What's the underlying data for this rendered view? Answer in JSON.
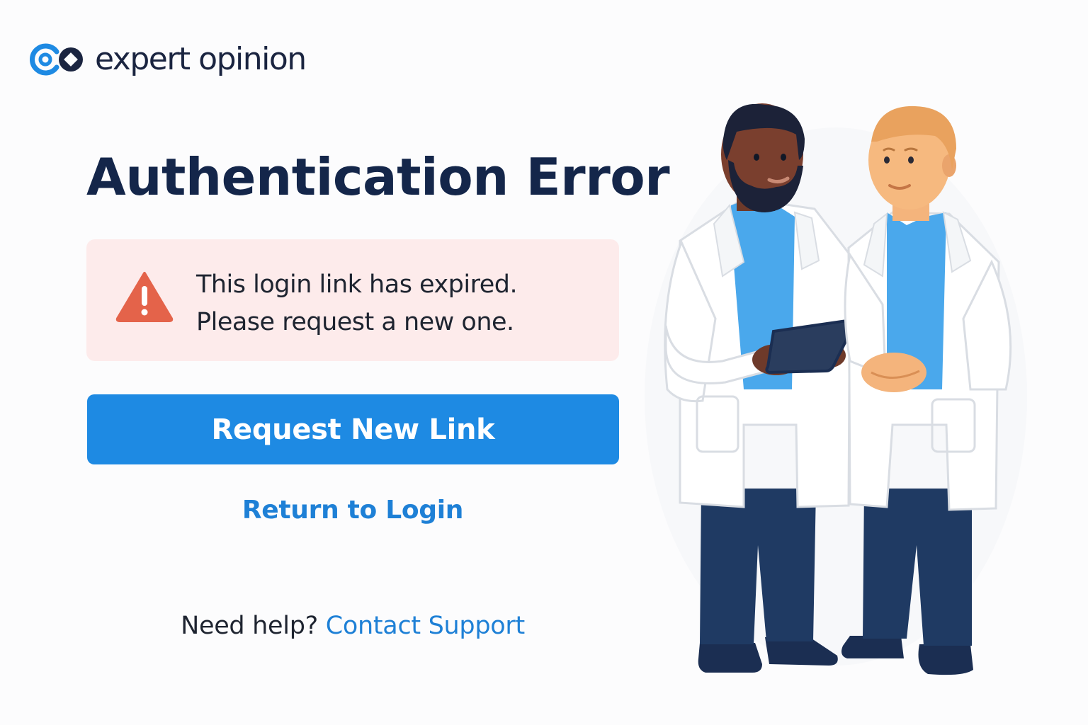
{
  "brand": {
    "name": "expert opinion",
    "primary_color": "#1e8ae3",
    "text_color": "#1a2440"
  },
  "page": {
    "title": "Authentication Error"
  },
  "alert": {
    "icon": "warning-triangle-icon",
    "color": "#e4634a",
    "background": "#fdebeb",
    "line1": "This login link has expired.",
    "line2": "Please request a new one."
  },
  "actions": {
    "request_new_link": "Request New Link",
    "return_to_login": "Return to Login"
  },
  "help": {
    "prompt": "Need help?",
    "contact_link": "Contact Support"
  },
  "illustration": {
    "subject": "two-doctors-illustration"
  }
}
